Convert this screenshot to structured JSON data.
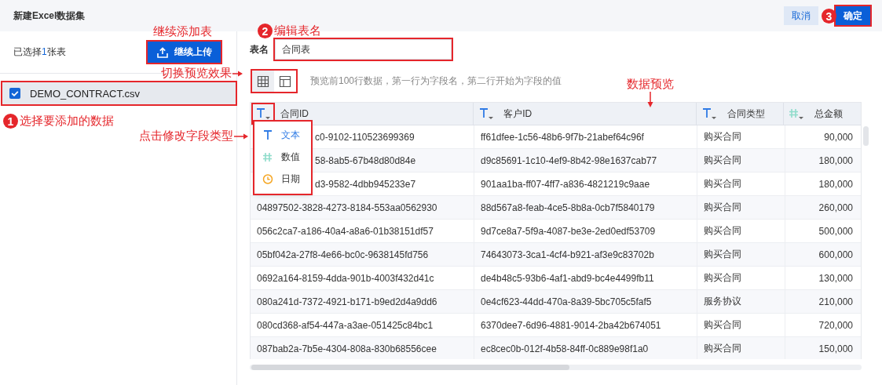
{
  "dialog": {
    "title": "新建Excel数据集",
    "buttons": [
      {
        "label": "取消",
        "kind": "secondary",
        "highlighted": false
      },
      {
        "label": "确定",
        "kind": "primary",
        "highlighted": true
      }
    ]
  },
  "left_panel": {
    "count_prefix": "已选择",
    "count": "1",
    "count_suffix": "张表",
    "upload_button": {
      "label": "继续上传",
      "highlighted": true
    },
    "files": [
      {
        "name": "DEMO_CONTRACT.csv",
        "checked": true,
        "selected": true,
        "highlighted": true
      }
    ]
  },
  "table_name": {
    "label": "表名",
    "value": "合同表",
    "highlighted": true
  },
  "view_toggle": {
    "highlighted": true,
    "options": [
      {
        "kind": "grid",
        "selected": true
      },
      {
        "kind": "layout",
        "selected": false
      }
    ]
  },
  "hint": "预览前100行数据，第一行为字段名，第二行开始为字段的值",
  "columns": [
    {
      "name": "合同ID",
      "kind": "text",
      "icon_highlighted": true
    },
    {
      "name": "客户ID",
      "kind": "text",
      "icon_highlighted": false
    },
    {
      "name": "合同类型",
      "kind": "text",
      "icon_highlighted": false
    },
    {
      "name": "总金额",
      "kind": "number",
      "icon_highlighted": false
    }
  ],
  "type_menu": {
    "highlighted": true,
    "items": [
      {
        "label": "文本",
        "kind": "text",
        "selected": true
      },
      {
        "label": "数值",
        "kind": "number",
        "selected": false
      },
      {
        "label": "日期",
        "kind": "date",
        "selected": false
      }
    ]
  },
  "rows": [
    {
      "first_cell_covered": true,
      "cells": [
        "c0-9102-110523699369",
        "ff61dfee-1c56-48b6-9f7b-21abef64c96f",
        "购买合同",
        "90,000"
      ]
    },
    {
      "first_cell_covered": true,
      "cells": [
        "58-8ab5-67b48d80d84e",
        "d9c85691-1c10-4ef9-8b42-98e1637cab77",
        "购买合同",
        "180,000"
      ]
    },
    {
      "first_cell_covered": true,
      "cells": [
        "d3-9582-4dbb945233e7",
        "901aa1ba-ff07-4ff7-a836-4821219c9aae",
        "购买合同",
        "180,000"
      ]
    },
    {
      "first_cell_covered": false,
      "cells": [
        "04897502-3828-4273-8184-553aa0562930",
        "88d567a8-feab-4ce5-8b8a-0cb7f5840179",
        "购买合同",
        "260,000"
      ]
    },
    {
      "first_cell_covered": false,
      "cells": [
        "056c2ca7-a186-40a4-a8a6-01b38151df57",
        "9d7ce8a7-5f9a-4087-be3e-2ed0edf53709",
        "购买合同",
        "500,000"
      ]
    },
    {
      "first_cell_covered": false,
      "cells": [
        "05bf042a-27f8-4e66-bc0c-9638145fd756",
        "74643073-3ca1-4cf4-b921-af3e9c83702b",
        "购买合同",
        "600,000"
      ]
    },
    {
      "first_cell_covered": false,
      "cells": [
        "0692a164-8159-4dda-901b-4003f432d41c",
        "de4b48c5-93b6-4af1-abd9-bc4e4499fb11",
        "购买合同",
        "130,000"
      ]
    },
    {
      "first_cell_covered": false,
      "cells": [
        "080a241d-7372-4921-b171-b9ed2d4a9dd6",
        "0e4cf623-44dd-470a-8a39-5bc705c5faf5",
        "服务协议",
        "210,000"
      ]
    },
    {
      "first_cell_covered": false,
      "cells": [
        "080cd368-af54-447a-a3ae-051425c84bc1",
        "6370dee7-6d96-4881-9014-2ba42b674051",
        "购买合同",
        "720,000"
      ]
    },
    {
      "first_cell_covered": false,
      "cells": [
        "087bab2a-7b5e-4304-808a-830b68556cee",
        "ec8cec0b-012f-4b58-84ff-0c889e98f1a0",
        "购买合同",
        "150,000"
      ]
    }
  ],
  "annotations": [
    {
      "kind": "step",
      "step": "3"
    },
    {
      "kind": "label",
      "text": "继续添加表"
    },
    {
      "kind": "step",
      "step": "2",
      "text": "编辑表名"
    },
    {
      "kind": "arrow-right",
      "text": "切换预览效果"
    },
    {
      "kind": "arrow-down",
      "text": "数据预览"
    },
    {
      "kind": "step",
      "step": "1",
      "text": "选择要添加的数据"
    },
    {
      "kind": "arrow-right",
      "text": "点击修改字段类型"
    }
  ]
}
